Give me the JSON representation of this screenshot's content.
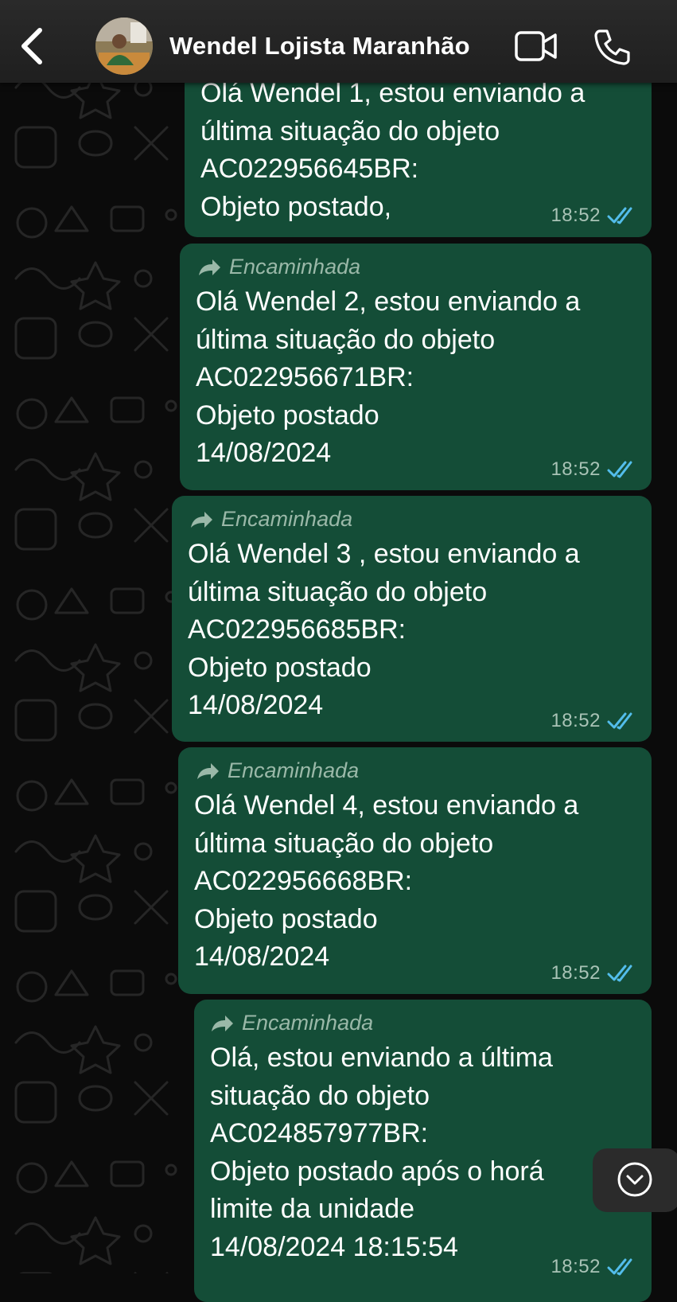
{
  "header": {
    "contact_name": "Wendel Lojista Maranhão",
    "icons": {
      "back": "chevron-left-icon",
      "video": "video-camera-icon",
      "call": "phone-icon"
    }
  },
  "messages": [
    {
      "forwarded_label": "",
      "lines": [
        "Olá Wendel 1, estou enviando a",
        "última situação do objeto",
        "AC022956645BR:",
        "Objeto postado,"
      ],
      "time": "18:52",
      "status": "read"
    },
    {
      "forwarded_label": "Encaminhada",
      "lines": [
        "Olá Wendel 2, estou enviando a",
        "última situação do objeto",
        "AC022956671BR:",
        "Objeto postado",
        "14/08/2024"
      ],
      "time": "18:52",
      "status": "read"
    },
    {
      "forwarded_label": "Encaminhada",
      "lines": [
        "Olá Wendel 3 , estou enviando a",
        "última situação do objeto",
        "AC022956685BR:",
        "Objeto postado",
        "14/08/2024"
      ],
      "time": "18:52",
      "status": "read"
    },
    {
      "forwarded_label": "Encaminhada",
      "lines": [
        "Olá Wendel 4, estou enviando a",
        "última situação do objeto",
        "AC022956668BR:",
        "Objeto postado",
        "14/08/2024"
      ],
      "time": "18:52",
      "status": "read"
    },
    {
      "forwarded_label": "Encaminhada",
      "lines": [
        "Olá, estou enviando a última",
        "situação do objeto",
        "AC024857977BR:",
        "Objeto postado após o horá",
        "limite da unidade",
        "14/08/2024 18:15:54"
      ],
      "time": "18:52",
      "status": "read"
    }
  ],
  "colors": {
    "bubble": "#144d37",
    "read_ticks": "#53bdeb",
    "forwarded_label": "#9ab8a8"
  },
  "scroll_down_icon": "chevron-down-circle-icon"
}
